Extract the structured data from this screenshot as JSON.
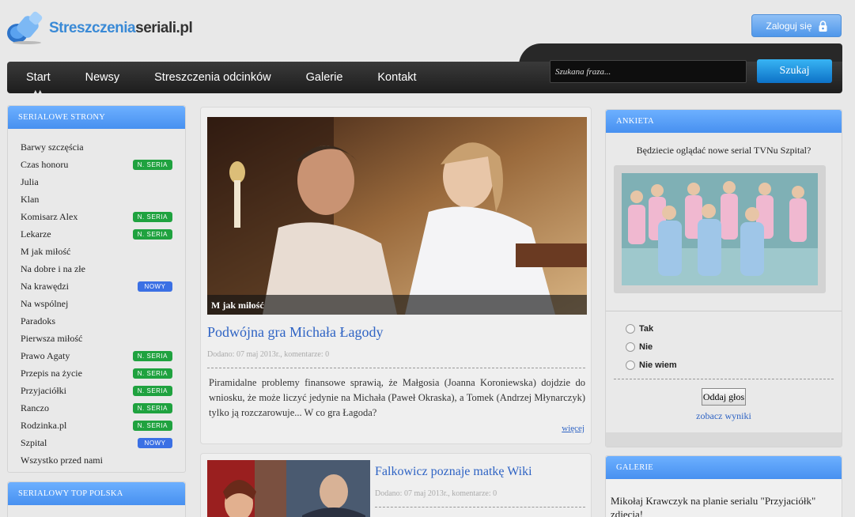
{
  "header": {
    "logo_a": "Streszczenia",
    "logo_b": "seriali.pl",
    "login_label": "Zaloguj się"
  },
  "nav": {
    "items": [
      "Start",
      "Newsy",
      "Streszczenia odcinków",
      "Galerie",
      "Kontakt"
    ],
    "search_placeholder": "Szukana fraza...",
    "search_button": "Szukaj"
  },
  "left": {
    "title": "SERIALOWE STRONY",
    "items": [
      {
        "name": "Barwy szczęścia",
        "badge": ""
      },
      {
        "name": "Czas honoru",
        "badge": "N. SERIA"
      },
      {
        "name": "Julia",
        "badge": ""
      },
      {
        "name": "Klan",
        "badge": ""
      },
      {
        "name": "Komisarz Alex",
        "badge": "N. SERIA"
      },
      {
        "name": "Lekarze",
        "badge": "N. SERIA"
      },
      {
        "name": "M jak miłość",
        "badge": ""
      },
      {
        "name": "Na dobre i na złe",
        "badge": ""
      },
      {
        "name": "Na krawędzi",
        "badge": "NOWY"
      },
      {
        "name": "Na wspólnej",
        "badge": ""
      },
      {
        "name": "Paradoks",
        "badge": ""
      },
      {
        "name": "Pierwsza miłość",
        "badge": ""
      },
      {
        "name": "Prawo Agaty",
        "badge": "N. SERIA"
      },
      {
        "name": "Przepis na życie",
        "badge": "N. SERIA"
      },
      {
        "name": "Przyjaciółki",
        "badge": "N. SERIA"
      },
      {
        "name": "Ranczo",
        "badge": "N. SERIA"
      },
      {
        "name": "Rodzinka.pl",
        "badge": "N. SERIA"
      },
      {
        "name": "Szpital",
        "badge": "NOWY"
      },
      {
        "name": "Wszystko przed nami",
        "badge": ""
      }
    ],
    "top_title": "SERIALOWY TOP POLSKA"
  },
  "main": {
    "hero_caption": "M jak miłość",
    "article1": {
      "title": "Podwójna gra Michała Łagody",
      "meta": "Dodano: 07 maj 2013r., komentarze: 0",
      "excerpt": "Piramidalne problemy finansowe sprawią, że Małgosia (Joanna Koroniewska) dojdzie do wniosku, że może liczyć jedynie na Michała (Paweł Okraska), a Tomek (Andrzej Młynarczyk) tylko ją rozczarowuje... W co gra Łagoda?",
      "more": "więcej"
    },
    "article2": {
      "title": "Falkowicz poznaje matkę Wiki",
      "meta": "Dodano: 07 maj 2013r., komentarze: 0"
    }
  },
  "right": {
    "poll_title": "ANKIETA",
    "question": "Będziecie oglądać nowe serial TVNu Szpital?",
    "options": [
      "Tak",
      "Nie",
      "Nie wiem"
    ],
    "vote": "Oddaj głos",
    "results": "zobacz wyniki",
    "gallery_title": "GALERIE",
    "gallery_text": "Mikołaj Krawczyk na planie serialu \"Przyjaciółk\" zdjecia!"
  }
}
